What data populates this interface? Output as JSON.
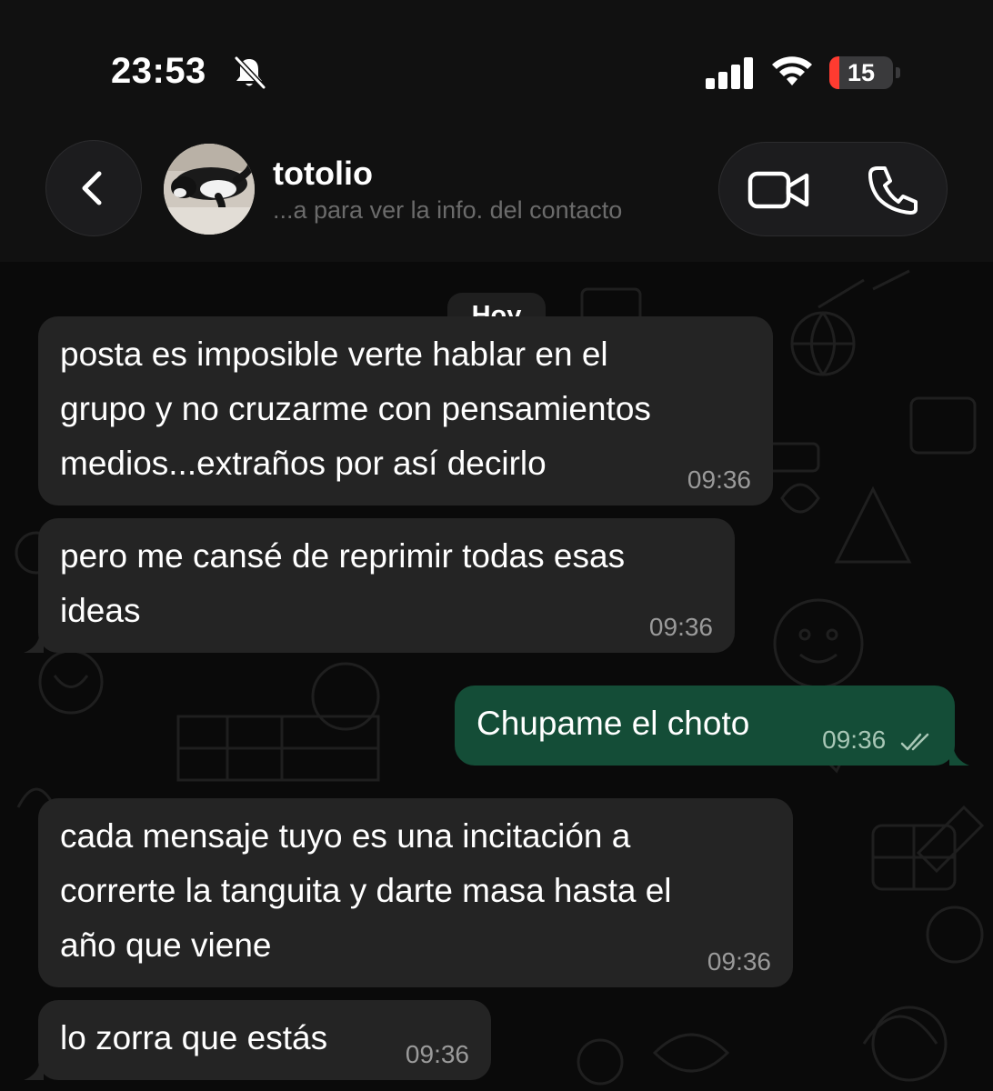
{
  "status_bar": {
    "time": "23:53",
    "battery_level": "15",
    "battery_fraction": 0.15,
    "icons": [
      "bell-off-icon",
      "signal-icon",
      "wifi-icon",
      "battery-icon"
    ]
  },
  "header": {
    "contact_name": "totolio",
    "subtitle": "...a para ver la info. del contacto",
    "icons": [
      "back-chevron-icon",
      "video-camera-icon",
      "phone-icon"
    ]
  },
  "chat": {
    "date_label": "Hoy",
    "messages": [
      {
        "direction": "incoming",
        "text": "posta es imposible verte hablar en el\ngrupo y no cruzarme con pensamientos\nmedios...extraños por así decirlo",
        "time": "09:36"
      },
      {
        "direction": "incoming",
        "text": "pero me cansé de reprimir todas esas\nideas",
        "time": "09:36"
      },
      {
        "direction": "outgoing",
        "text": "Chupame el choto",
        "time": "09:36",
        "status": "read-double-check"
      },
      {
        "direction": "incoming",
        "text": "cada mensaje tuyo es una incitación a\ncorrerte la tanguita y darte masa hasta el\naño que viene",
        "time": "09:36"
      },
      {
        "direction": "incoming",
        "text": "lo zorra que estás",
        "time": "09:36"
      }
    ]
  },
  "colors": {
    "background": "#0b0b0b",
    "incoming_bubble": "#242424",
    "outgoing_bubble": "#144d37",
    "timestamp": "#9a9a9a",
    "battery_low": "#ff3b30"
  }
}
